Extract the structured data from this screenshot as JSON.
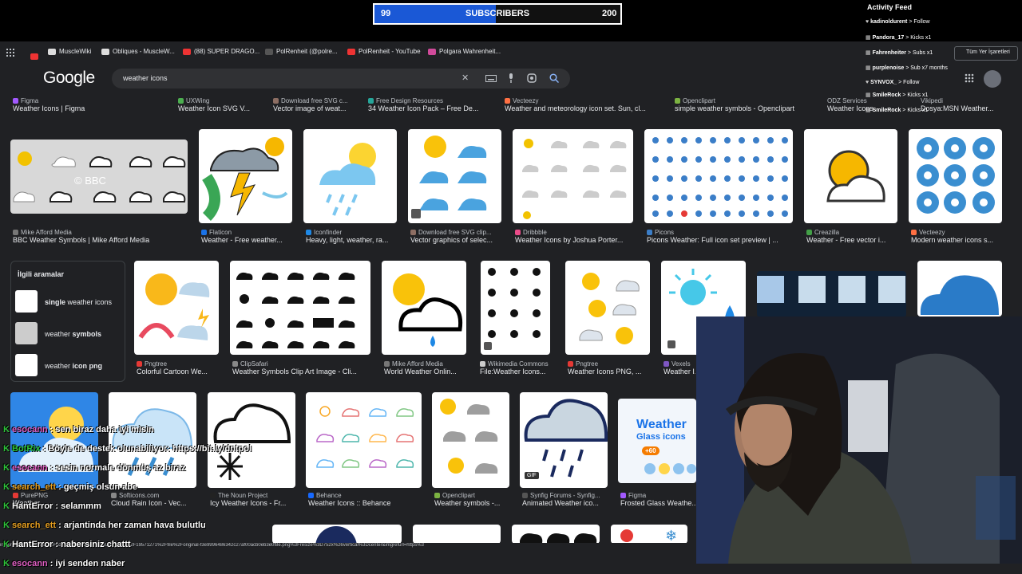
{
  "subscriber_goal": {
    "current": "99",
    "label": "SUBSCRIBERS",
    "target": "200",
    "fill_fraction": 0.495
  },
  "bookmarks": [
    {
      "label": "MuscleWiki",
      "icon": "musclewiki-icon"
    },
    {
      "label": "Obliques - MuscleW...",
      "icon": "musclewiki-icon"
    },
    {
      "label": "(88) SUPER DRAGO...",
      "icon": "youtube-icon"
    },
    {
      "label": "PolRenheit (@polre...",
      "icon": "tiktok-icon"
    },
    {
      "label": "PolRenheit - YouTube",
      "icon": "youtube-icon"
    },
    {
      "label": "Polgara Wahrenheit...",
      "icon": "instagram-icon"
    }
  ],
  "google": {
    "logo": "Google",
    "query": "weather icons"
  },
  "top_sources": [
    {
      "source": "Figma",
      "title": "Weather Icons | Figma"
    },
    {
      "source": "UXWing",
      "title": "Weather Icon SVG V..."
    },
    {
      "source": "Download free SVG c...",
      "title": "Vector image of weat..."
    },
    {
      "source": "Free Design Resources",
      "title": "34 Weather Icon Pack – Free De..."
    },
    {
      "source": "Vecteezy",
      "title": "Weather and meteorology icon set. Sun, cl..."
    },
    {
      "source": "Openclipart",
      "title": "simple weather symbols - Openclipart"
    },
    {
      "source": "ODZ Services",
      "title": "Weather Icons"
    },
    {
      "source": "Vikipedi",
      "title": "Dosya:MSN Weather..."
    }
  ],
  "row1": [
    {
      "source": "Mike Afford Media",
      "title": "BBC Weather Symbols | Mike Afford Media"
    },
    {
      "source": "Flaticon",
      "title": "Weather - Free weather..."
    },
    {
      "source": "Iconfinder",
      "title": "Heavy, light, weather, ra..."
    },
    {
      "source": "Download free SVG clip...",
      "title": "Vector graphics of selec..."
    },
    {
      "source": "Dribbble",
      "title": "Weather Icons by Joshua Porter..."
    },
    {
      "source": "Picons",
      "title": "Picons Weather: Full icon set preview | ..."
    },
    {
      "source": "Creazilla",
      "title": "Weather - Free vector i..."
    },
    {
      "source": "Vecteezy",
      "title": "Modern weather icons s..."
    }
  ],
  "related": {
    "title": "İlgili aramalar",
    "items": [
      {
        "pre": "single ",
        "bold": "weather icons",
        "post": ""
      },
      {
        "pre": "weather ",
        "bold": "symbols",
        "post": ""
      },
      {
        "pre": "weather ",
        "bold": "icon png",
        "post": ""
      }
    ]
  },
  "row2": [
    {
      "source": "Pngtree",
      "title": "Colorful Cartoon We..."
    },
    {
      "source": "ClipSafari",
      "title": "Weather Symbols Clip Art Image - Cli..."
    },
    {
      "source": "Mike Afford Media",
      "title": "World Weather Onlin..."
    },
    {
      "source": "Wikimedia Commons",
      "title": "File:Weather Icons..."
    },
    {
      "source": "Pngtree",
      "title": "Weather Icons PNG, ..."
    },
    {
      "source": "Vexels",
      "title": "Weather I..."
    }
  ],
  "row3": [
    {
      "source": "PurePNG",
      "title": "Weather..."
    },
    {
      "source": "Softicons.com",
      "title": "Cloud Rain Icon - Vec..."
    },
    {
      "source": "The Noun Project",
      "title": "Icy Weather Icons - Fr..."
    },
    {
      "source": "Behance",
      "title": "Weather Icons :: Behance"
    },
    {
      "source": "Openclipart",
      "title": "Weather symbols -..."
    },
    {
      "source": "Synfig Forums - Synfig...",
      "title": "Animated Weather ico..."
    },
    {
      "source": "Figma",
      "title": "Frosted Glass Weathe..."
    }
  ],
  "glass_tile": {
    "line1": "Weather",
    "line2": "Glass icons",
    "badge": "+60"
  },
  "gif_badge": "GIF",
  "activity_feed": {
    "title": "Activity Feed",
    "items": [
      {
        "name": "kadinoldurent",
        "event": " > Follow"
      },
      {
        "name": "Pandora_17",
        "event": " > Kicks x1"
      },
      {
        "name": "Fahrenheiter",
        "event": " > Subs x1"
      },
      {
        "name": "purplenoise",
        "event": " > Sub x7 months"
      },
      {
        "name": "SYNVOX_",
        "event": " > Follow"
      },
      {
        "name": "SmileRock",
        "event": " > Kicks x1"
      },
      {
        "name": "SmileRock",
        "event": " > Kicks x1"
      }
    ],
    "bookmark_folder": "Tüm Yer İşaretleri"
  },
  "chat": [
    {
      "user": "esocann",
      "msg": " : sen biraz daha iyi misin",
      "color": "#e05fc3"
    },
    {
      "user": "BotRix",
      "msg": " : Böyle de destek olunabiliyor: https://bit.ly/dntpol",
      "color": "#2ec43a"
    },
    {
      "user": "esocann",
      "msg": " : sesin normale dönmüş az biraz",
      "color": "#e05fc3"
    },
    {
      "user": "search_ett",
      "msg": " : geçmiş olsun abe",
      "color": "#e8a020"
    },
    {
      "user": "HantError",
      "msg": " : selammm",
      "color": "#ffffff"
    },
    {
      "user": "search_ett",
      "msg": " : arjantinda her zaman hava bulutlu",
      "color": "#e8a020"
    },
    {
      "user": "HantError",
      "msg": " : nabersiniz chattt",
      "color": "#ffffff"
    },
    {
      "user": "esocann",
      "msg": " : iyi senden naber",
      "color": "#e05fc3"
    }
  ],
  "status_url": "imgurl=https%3A%2F%2Fcdn.dribbble.com%2Fuserupload%2F19571271%2Ffile%2Foriginal-f3e9996486342c27af00acb0eb3e0f8e.png%3Fresize%3D752x%26vertical%3Dcenter&imgrefurl=https%3"
}
